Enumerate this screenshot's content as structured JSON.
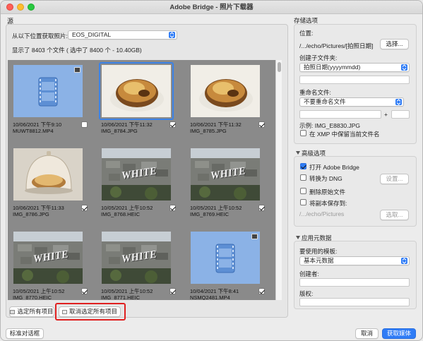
{
  "window": {
    "title": "Adobe Bridge - 照片下载器"
  },
  "source": {
    "section_label": "源",
    "get_from_label": "从以下位置获取照片:",
    "device": "EOS_DIGITAL",
    "summary": "显示了 8403 个文件 ( 选中了 8400 个 - 10.40GB)"
  },
  "thumbnails": [
    {
      "type": "video",
      "date": "10/06/2021 下午9:10",
      "file": "MUWT8812.MP4",
      "checked": false,
      "selected": false
    },
    {
      "type": "cake",
      "date": "10/06/2021 下午11:32",
      "file": "IMG_8784.JPG",
      "checked": true,
      "selected": true
    },
    {
      "type": "cake",
      "date": "10/06/2021 下午11:32",
      "file": "IMG_8785.JPG",
      "checked": true,
      "selected": false
    },
    {
      "type": "dome",
      "date": "10/06/2021 下午11:33",
      "file": "IMG_8786.JPG",
      "checked": true,
      "selected": false
    },
    {
      "type": "wall",
      "date": "10/05/2021 上午10:52",
      "file": "IMG_8768.HEIC",
      "checked": true,
      "selected": false
    },
    {
      "type": "wall",
      "date": "10/05/2021 上午10:52",
      "file": "IMG_8769.HEIC",
      "checked": true,
      "selected": false
    },
    {
      "type": "wall",
      "date": "10/05/2021 上午10:52",
      "file": "IMG_8770.HEIC",
      "checked": true,
      "selected": false
    },
    {
      "type": "wall",
      "date": "10/05/2021 上午10:52",
      "file": "IMG_8771.HEIC",
      "checked": true,
      "selected": false
    },
    {
      "type": "video",
      "date": "10/04/2021 下午8:41",
      "file": "NSMQ2481.MP4",
      "checked": true,
      "selected": false
    }
  ],
  "wall_text": "WHITE",
  "buttons": {
    "select_all": "选定所有项目",
    "deselect_all": "取消选定所有项目",
    "standard_dialog": "标准对话框",
    "cancel": "取消",
    "get_media": "获取媒体"
  },
  "save_options": {
    "title": "存储选项",
    "location_label": "位置:",
    "location_value": "/.../echo/Pictures/[拍照日期]",
    "choose_button": "选择...",
    "subfolder_label": "创建子文件夹:",
    "subfolder_value": "拍照日期(yyyymmdd)",
    "rename_label": "重命名文件:",
    "rename_value": "不要重命名文件",
    "plus": "+",
    "example": "示例: IMG_E8830.JPG",
    "keep_in_xmp": "在 XMP 中保留当前文件名"
  },
  "advanced": {
    "title": "高级选项",
    "open_bridge": "打开 Adobe Bridge",
    "convert_dng": "转换为 DNG",
    "settings_button": "设置...",
    "delete_original": "删除原始文件",
    "save_copy_to": "将副本保存到:",
    "copy_path": "/.../echo/Pictures",
    "choose_button": "选取..."
  },
  "metadata": {
    "title": "应用元数据",
    "template_label": "要使用的模板:",
    "template_value": "基本元数据",
    "creator_label": "创建者:",
    "copyright_label": "版权:"
  },
  "colors": {
    "accent": "#2f7cf6",
    "highlight": "#e02020",
    "selection": "#3b82e6"
  }
}
